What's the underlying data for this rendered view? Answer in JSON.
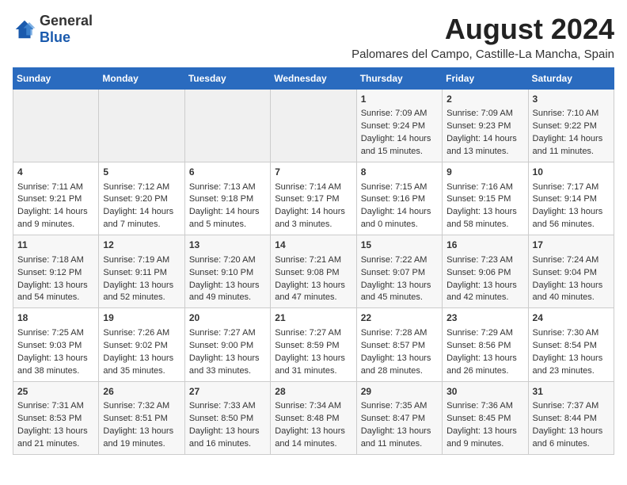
{
  "logo": {
    "text_general": "General",
    "text_blue": "Blue"
  },
  "title": "August 2024",
  "subtitle": "Palomares del Campo, Castille-La Mancha, Spain",
  "days_of_week": [
    "Sunday",
    "Monday",
    "Tuesday",
    "Wednesday",
    "Thursday",
    "Friday",
    "Saturday"
  ],
  "weeks": [
    [
      {
        "day": "",
        "empty": true
      },
      {
        "day": "",
        "empty": true
      },
      {
        "day": "",
        "empty": true
      },
      {
        "day": "",
        "empty": true
      },
      {
        "day": "1",
        "sunrise": "7:09 AM",
        "sunset": "9:24 PM",
        "daylight": "14 hours and 15 minutes."
      },
      {
        "day": "2",
        "sunrise": "7:09 AM",
        "sunset": "9:23 PM",
        "daylight": "14 hours and 13 minutes."
      },
      {
        "day": "3",
        "sunrise": "7:10 AM",
        "sunset": "9:22 PM",
        "daylight": "14 hours and 11 minutes."
      }
    ],
    [
      {
        "day": "4",
        "sunrise": "7:11 AM",
        "sunset": "9:21 PM",
        "daylight": "14 hours and 9 minutes."
      },
      {
        "day": "5",
        "sunrise": "7:12 AM",
        "sunset": "9:20 PM",
        "daylight": "14 hours and 7 minutes."
      },
      {
        "day": "6",
        "sunrise": "7:13 AM",
        "sunset": "9:18 PM",
        "daylight": "14 hours and 5 minutes."
      },
      {
        "day": "7",
        "sunrise": "7:14 AM",
        "sunset": "9:17 PM",
        "daylight": "14 hours and 3 minutes."
      },
      {
        "day": "8",
        "sunrise": "7:15 AM",
        "sunset": "9:16 PM",
        "daylight": "14 hours and 0 minutes."
      },
      {
        "day": "9",
        "sunrise": "7:16 AM",
        "sunset": "9:15 PM",
        "daylight": "13 hours and 58 minutes."
      },
      {
        "day": "10",
        "sunrise": "7:17 AM",
        "sunset": "9:14 PM",
        "daylight": "13 hours and 56 minutes."
      }
    ],
    [
      {
        "day": "11",
        "sunrise": "7:18 AM",
        "sunset": "9:12 PM",
        "daylight": "13 hours and 54 minutes."
      },
      {
        "day": "12",
        "sunrise": "7:19 AM",
        "sunset": "9:11 PM",
        "daylight": "13 hours and 52 minutes."
      },
      {
        "day": "13",
        "sunrise": "7:20 AM",
        "sunset": "9:10 PM",
        "daylight": "13 hours and 49 minutes."
      },
      {
        "day": "14",
        "sunrise": "7:21 AM",
        "sunset": "9:08 PM",
        "daylight": "13 hours and 47 minutes."
      },
      {
        "day": "15",
        "sunrise": "7:22 AM",
        "sunset": "9:07 PM",
        "daylight": "13 hours and 45 minutes."
      },
      {
        "day": "16",
        "sunrise": "7:23 AM",
        "sunset": "9:06 PM",
        "daylight": "13 hours and 42 minutes."
      },
      {
        "day": "17",
        "sunrise": "7:24 AM",
        "sunset": "9:04 PM",
        "daylight": "13 hours and 40 minutes."
      }
    ],
    [
      {
        "day": "18",
        "sunrise": "7:25 AM",
        "sunset": "9:03 PM",
        "daylight": "13 hours and 38 minutes."
      },
      {
        "day": "19",
        "sunrise": "7:26 AM",
        "sunset": "9:02 PM",
        "daylight": "13 hours and 35 minutes."
      },
      {
        "day": "20",
        "sunrise": "7:27 AM",
        "sunset": "9:00 PM",
        "daylight": "13 hours and 33 minutes."
      },
      {
        "day": "21",
        "sunrise": "7:27 AM",
        "sunset": "8:59 PM",
        "daylight": "13 hours and 31 minutes."
      },
      {
        "day": "22",
        "sunrise": "7:28 AM",
        "sunset": "8:57 PM",
        "daylight": "13 hours and 28 minutes."
      },
      {
        "day": "23",
        "sunrise": "7:29 AM",
        "sunset": "8:56 PM",
        "daylight": "13 hours and 26 minutes."
      },
      {
        "day": "24",
        "sunrise": "7:30 AM",
        "sunset": "8:54 PM",
        "daylight": "13 hours and 23 minutes."
      }
    ],
    [
      {
        "day": "25",
        "sunrise": "7:31 AM",
        "sunset": "8:53 PM",
        "daylight": "13 hours and 21 minutes."
      },
      {
        "day": "26",
        "sunrise": "7:32 AM",
        "sunset": "8:51 PM",
        "daylight": "13 hours and 19 minutes."
      },
      {
        "day": "27",
        "sunrise": "7:33 AM",
        "sunset": "8:50 PM",
        "daylight": "13 hours and 16 minutes."
      },
      {
        "day": "28",
        "sunrise": "7:34 AM",
        "sunset": "8:48 PM",
        "daylight": "13 hours and 14 minutes."
      },
      {
        "day": "29",
        "sunrise": "7:35 AM",
        "sunset": "8:47 PM",
        "daylight": "13 hours and 11 minutes."
      },
      {
        "day": "30",
        "sunrise": "7:36 AM",
        "sunset": "8:45 PM",
        "daylight": "13 hours and 9 minutes."
      },
      {
        "day": "31",
        "sunrise": "7:37 AM",
        "sunset": "8:44 PM",
        "daylight": "13 hours and 6 minutes."
      }
    ]
  ]
}
